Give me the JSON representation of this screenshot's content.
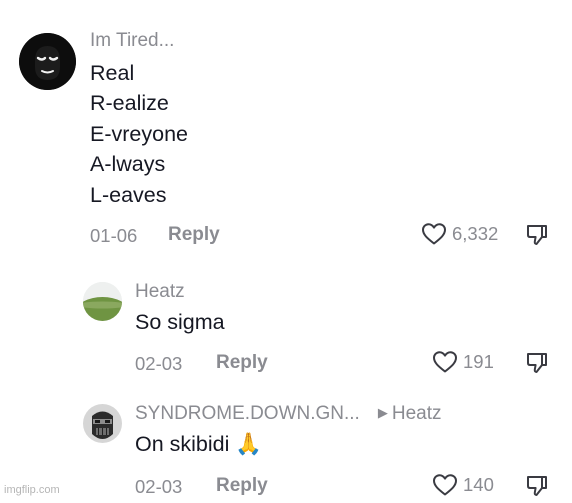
{
  "comments": [
    {
      "username": "Im Tired...",
      "lines": [
        "Real",
        "R-ealize",
        "E-vreyone",
        "A-lways",
        "L-eaves"
      ],
      "date": "01-06",
      "reply_label": "Reply",
      "likes": "6,332"
    },
    {
      "username": "Heatz",
      "lines": [
        "So sigma"
      ],
      "date": "02-03",
      "reply_label": "Reply",
      "likes": "191"
    },
    {
      "username": "SYNDROME.DOWN.GN...",
      "reply_to": "Heatz",
      "reply_arrow": "▶",
      "lines": [
        "On skibidi 🙏"
      ],
      "date": "02-03",
      "reply_label": "Reply",
      "likes": "140"
    }
  ],
  "icons": {
    "like": "heart-outline-icon",
    "dislike": "thumbs-down-outline-icon"
  },
  "watermark": "imgflip.com"
}
